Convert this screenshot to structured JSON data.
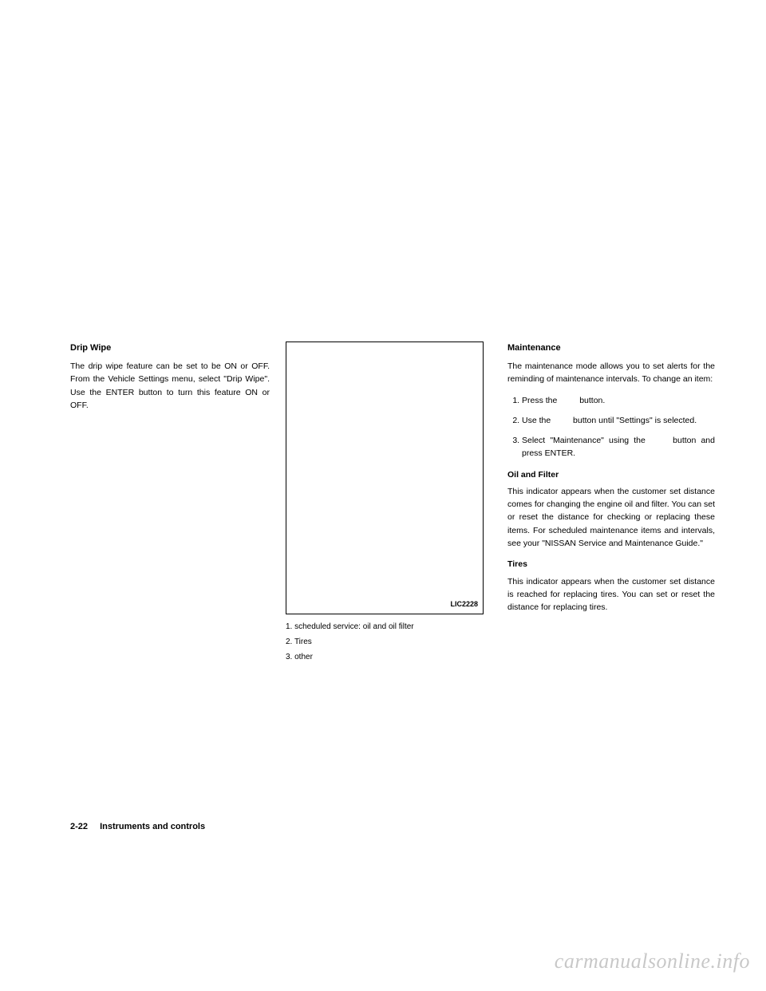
{
  "col1": {
    "heading": "Drip Wipe",
    "para": "The drip wipe feature can be set to be ON or OFF. From the Vehicle Settings menu, select \"Drip Wipe\". Use the ENTER button to turn this feature ON or OFF."
  },
  "col2": {
    "image_label": "LIC2228",
    "captions": {
      "c1": "1. scheduled service: oil and oil filter",
      "c2": "2. Tires",
      "c3": "3. other"
    }
  },
  "col3": {
    "heading": "Maintenance",
    "intro": "The maintenance mode allows you to set alerts for the reminding of maintenance intervals. To change an item:",
    "steps": {
      "s1a": "Press the",
      "s1b": "button.",
      "s2a": "Use the",
      "s2b": "button until \"Settings\" is selected.",
      "s3a": "Select \"Maintenance\" using the",
      "s3b": "button and press ENTER."
    },
    "oil_head": "Oil and Filter",
    "oil_para": "This indicator appears when the customer set distance comes for changing the engine oil and filter. You can set or reset the distance for checking or replacing these items. For scheduled maintenance items and intervals, see your \"NISSAN Service and Maintenance Guide.\"",
    "tires_head": "Tires",
    "tires_para": "This indicator appears when the customer set distance is reached for replacing tires. You can set or reset the distance for replacing tires."
  },
  "footer": {
    "page_num": "2-22",
    "section": "Instruments and controls"
  },
  "watermark": "carmanualsonline.info"
}
